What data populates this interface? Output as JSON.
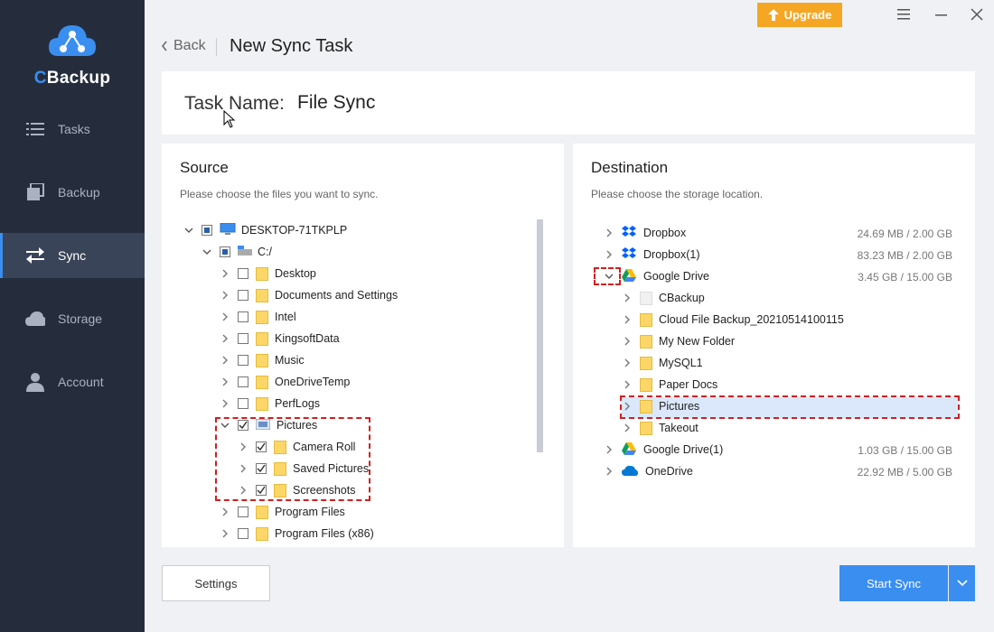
{
  "app": {
    "logo_prefix": "C",
    "logo_rest": "Backup"
  },
  "nav": [
    {
      "label": "Tasks",
      "icon": "list-icon"
    },
    {
      "label": "Backup",
      "icon": "copy-icon"
    },
    {
      "label": "Sync",
      "icon": "sync-arrows-icon",
      "active": true
    },
    {
      "label": "Storage",
      "icon": "cloud-icon"
    },
    {
      "label": "Account",
      "icon": "user-icon"
    }
  ],
  "topbar": {
    "upgrade_label": "Upgrade"
  },
  "header": {
    "back_label": "Back",
    "title": "New Sync Task"
  },
  "task": {
    "label": "Task Name:",
    "value": "File Sync"
  },
  "source": {
    "title": "Source",
    "subtitle": "Please choose the files you want to sync.",
    "root": "DESKTOP-71TKPLP",
    "drive": "C:/",
    "items": [
      "Desktop",
      "Documents and Settings",
      "Intel",
      "KingsoftData",
      "Music",
      "OneDriveTemp",
      "PerfLogs",
      "Pictures"
    ],
    "pictures_children": [
      "Camera Roll",
      "Saved Pictures",
      "Screenshots"
    ],
    "tail_items": [
      "Program Files",
      "Program Files (x86)"
    ]
  },
  "destination": {
    "title": "Destination",
    "subtitle": "Please choose the storage location.",
    "clouds": [
      {
        "name": "Dropbox",
        "size": "24.69 MB / 2.00 GB"
      },
      {
        "name": "Dropbox(1)",
        "size": "83.23 MB / 2.00 GB"
      },
      {
        "name": "Google Drive",
        "size": "3.45 GB / 15.00 GB"
      }
    ],
    "gdrive_children": [
      "CBackup",
      "Cloud File Backup_20210514100115",
      "My New Folder",
      "MySQL1",
      "Paper Docs",
      "Pictures",
      "Takeout"
    ],
    "tail_clouds": [
      {
        "name": "Google Drive(1)",
        "size": "1.03 GB / 15.00 GB"
      },
      {
        "name": "OneDrive",
        "size": "22.92 MB / 5.00 GB"
      }
    ]
  },
  "footer": {
    "settings_label": "Settings",
    "start_label": "Start Sync"
  },
  "colors": {
    "accent": "#3a8ef0",
    "sidebar": "#252d3d",
    "upgrade": "#f5a623",
    "highlight": "#d21f1f"
  }
}
